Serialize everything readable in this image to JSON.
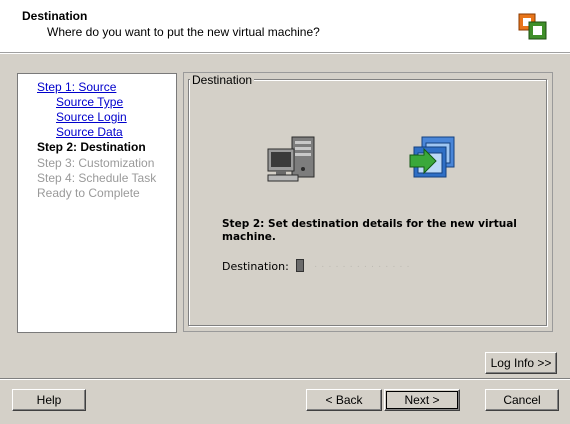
{
  "header": {
    "title": "Destination",
    "subtitle": "Where do you want to put the new virtual machine?",
    "icon": "wizard-logo-icon"
  },
  "steps": [
    {
      "label": "Step 1: Source",
      "state": "link"
    },
    {
      "label": "Source Type",
      "state": "link"
    },
    {
      "label": "Source Login",
      "state": "link"
    },
    {
      "label": "Source Data",
      "state": "link"
    },
    {
      "label": "Step 2: Destination",
      "state": "current"
    },
    {
      "label": "Step 3: Customization",
      "state": "pending"
    },
    {
      "label": "Step 4: Schedule Task",
      "state": "pending"
    },
    {
      "label": "Ready to Complete",
      "state": "pending"
    }
  ],
  "content": {
    "group_label": "Destination",
    "icons": [
      "server-computer-icon",
      "virtual-machine-import-icon"
    ],
    "description": "Step 2: Set destination details for the new virtual machine.",
    "destination_label": "Destination:",
    "destination_value": "· · · · · · ·  · · · · · · ·"
  },
  "buttons": {
    "log_info": "Log Info >>",
    "help": "Help",
    "back": "< Back",
    "next": "Next >",
    "cancel": "Cancel"
  },
  "colors": {
    "link": "#0000cc",
    "pending": "#9a9a9a",
    "dialog_bg": "#d4d0c8"
  }
}
